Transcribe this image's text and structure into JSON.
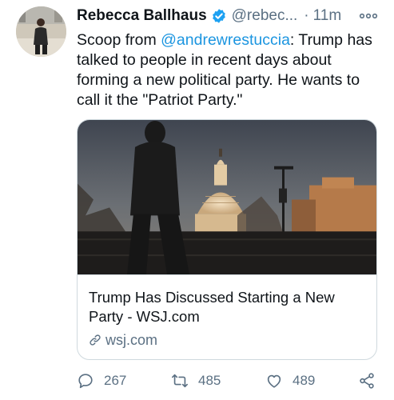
{
  "tweet": {
    "author_name": "Rebecca Ballhaus",
    "handle": "@rebec...",
    "separator": "·",
    "time": "11m",
    "text_before_mention": "Scoop from ",
    "mention": "@andrewrestuccia",
    "text_after_mention": ": Trump has talked to people in recent days about forming a new political party. He wants to call it the \"Patriot Party.\""
  },
  "card": {
    "title": "Trump Has Discussed Starting a New Party - WSJ.com",
    "domain": "wsj.com"
  },
  "actions": {
    "replies": "267",
    "retweets": "485",
    "likes": "489"
  },
  "colors": {
    "accent": "#1b95e0",
    "verified": "#1da1f2",
    "secondary_text": "#5b7083",
    "border": "#cfd9de"
  },
  "icons": [
    "verified-badge-icon",
    "more-icon",
    "link-icon",
    "reply-icon",
    "retweet-icon",
    "like-icon",
    "share-icon"
  ]
}
